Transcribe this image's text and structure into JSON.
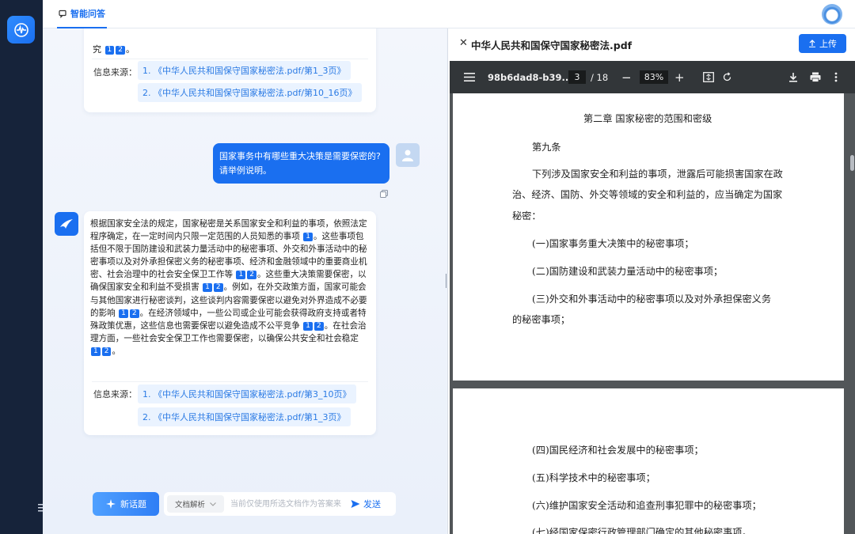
{
  "app": {
    "tab_label": "智能问答"
  },
  "chat": {
    "top_card": {
      "tail_text": "究",
      "source_label": "信息来源：",
      "sources": [
        "1. 《中华人民共和国保守国家秘密法.pdf/第1_3页》",
        "2. 《中华人民共和国保守国家秘密法.pdf/第10_16页》"
      ]
    },
    "user_message": "国家事务中有哪些重大决策是需要保密的?请举例说明。",
    "answer": {
      "segments": [
        "根据国家安全法的规定，国家秘密是关系国家安全和利益的事项，依照法定程序确定，在一定时间内只限一定范围的人员知悉的事项",
        "。这些事项包括但不限于国防建设和武装力量活动中的秘密事项、外交和外事活动中的秘密事项以及对外承担保密义务的秘密事项、经济和金融领域中的重要商业机密、社会治理中的社会安全保卫工作等",
        "。这些重大决策需要保密，以确保国家安全和利益不受损害",
        "。例如，在外交政策方面，国家可能会与其他国家进行秘密谈判，这些谈判内容需要保密以避免对外界造成不必要的影响",
        "。在经济领域中，一些公司或企业可能会获得政府支持或者特殊政策优惠，这些信息也需要保密以避免造成不公平竞争",
        "。在社会治理方面，一些社会安全保卫工作也需要保密，以确保公共安全和社会稳定",
        "。"
      ],
      "source_label": "信息来源：",
      "sources": [
        "1. 《中华人民共和国保守国家秘密法.pdf/第3_10页》",
        "2. 《中华人民共和国保守国家秘密法.pdf/第1_3页》"
      ]
    },
    "ref1": "1",
    "ref2": "2",
    "new_topic_label": "新话题",
    "doc_select_value": "文档解析",
    "input_placeholder": "当前仅使用所选文档作为答案来",
    "send_label": "发送"
  },
  "pdf": {
    "title": "中华人民共和国保守国家秘密法.pdf",
    "upload_label": "上传",
    "file_name": "98b6dad8-b39...",
    "current_page": "3",
    "total_pages": "/ 18",
    "zoom": "83%",
    "page1": {
      "chapter": "第二章  国家秘密的范围和密级",
      "article": "第九条",
      "para_line1": "下列涉及国家安全和利益的事项，泄露后可能损害国家在政",
      "para_line2": "治、经济、国防、外交等领域的安全和利益的，应当确定为国家",
      "para_line3": "秘密：",
      "item1": "(一)国家事务重大决策中的秘密事项；",
      "item2": "(二)国防建设和武装力量活动中的秘密事项；",
      "item3_line1": "(三)外交和外事活动中的秘密事项以及对外承担保密义务",
      "item3_line2": "的秘密事项；"
    },
    "page2": {
      "item4": "(四)国民经济和社会发展中的秘密事项；",
      "item5": "(五)科学技术中的秘密事项；",
      "item6": "(六)维护国家安全活动和追查刑事犯罪中的秘密事项；",
      "item7": "(七)经国家保密行政管理部门确定的其他秘密事项。"
    }
  },
  "colors": {
    "accent": "#1a6ff0",
    "rail": "#16233a",
    "pdf_toolbar": "#323639"
  }
}
